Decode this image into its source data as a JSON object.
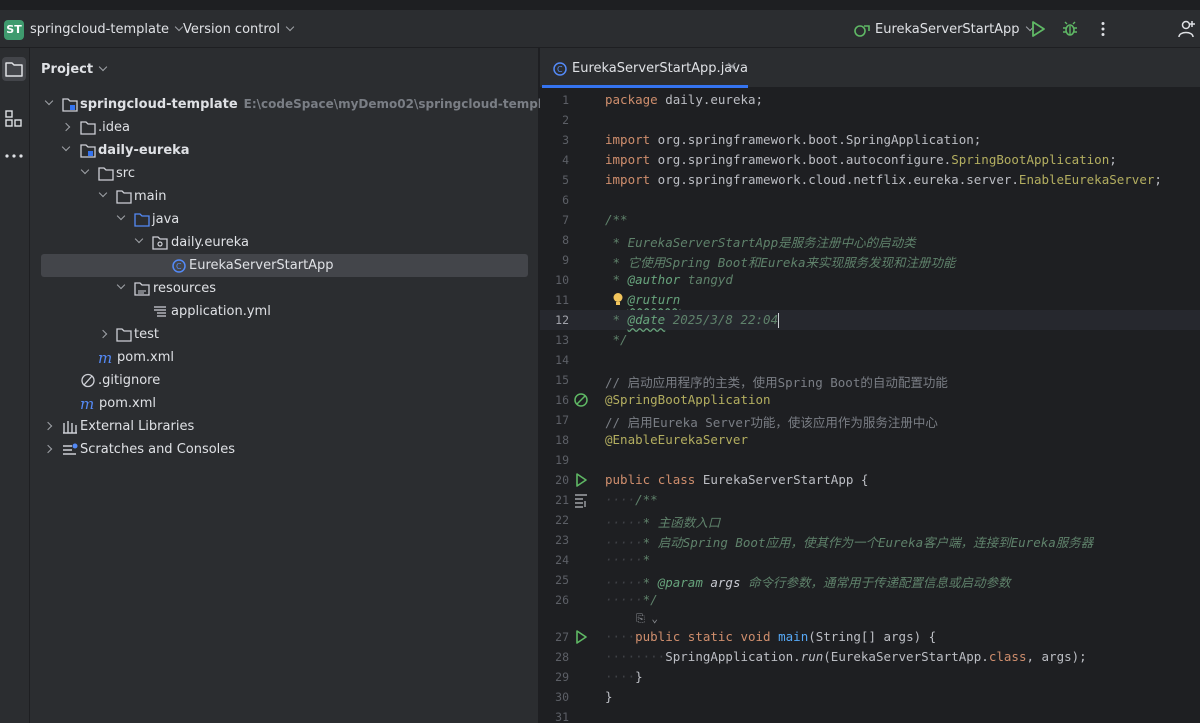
{
  "titlebar": {
    "project_badge": "ST",
    "project_name": "springcloud-template",
    "vcs_label": "Version control",
    "run_config": "EurekaServerStartApp"
  },
  "project_panel": {
    "title": "Project",
    "tree": [
      {
        "label": "springcloud-template",
        "path": "E:\\codeSpace\\myDemo02\\springcloud-template"
      },
      {
        "label": ".idea"
      },
      {
        "label": "daily-eureka"
      },
      {
        "label": "src"
      },
      {
        "label": "main"
      },
      {
        "label": "java"
      },
      {
        "label": "daily.eureka"
      },
      {
        "label": "EurekaServerStartApp"
      },
      {
        "label": "resources"
      },
      {
        "label": "application.yml"
      },
      {
        "label": "test"
      },
      {
        "label": "pom.xml"
      },
      {
        "label": ".gitignore"
      },
      {
        "label": "pom.xml"
      },
      {
        "label": "External Libraries"
      },
      {
        "label": "Scratches and Consoles"
      }
    ]
  },
  "editor": {
    "tab_label": "EurekaServerStartApp.java",
    "tab_close": "×",
    "current_line": 12,
    "inlay_hint": "⎘ ⌄",
    "lines": {
      "n": [
        "1",
        "2",
        "3",
        "4",
        "5",
        "6",
        "7",
        "8",
        "9",
        "10",
        "11",
        "12",
        "13",
        "14",
        "15",
        "16",
        "17",
        "18",
        "19",
        "20",
        "21",
        "22",
        "23",
        "24",
        "25",
        "26",
        "27",
        "28",
        "29",
        "30",
        "31"
      ],
      "l1": [
        "package",
        " daily.eureka;"
      ],
      "l3": [
        "import",
        " org.springframework.boot.SpringApplication;"
      ],
      "l4": [
        "import",
        " org.springframework.boot.autoconfigure.",
        "SpringBootApplication",
        ";"
      ],
      "l5": [
        "import",
        " org.springframework.cloud.netflix.eureka.server.",
        "EnableEurekaServer",
        ";"
      ],
      "l7": "/**",
      "l8": " * EurekaServerStartApp是服务注册中心的启动类",
      "l9": " * 它使用Spring Boot和Eureka来实现服务发现和注册功能",
      "l10": [
        " * ",
        "@author",
        " tangyd"
      ],
      "l11": [
        " ",
        "@ruturn"
      ],
      "l12": [
        " * ",
        "@date",
        " 2025/3/8 22:04"
      ],
      "l13": " */",
      "l15": "// 启动应用程序的主类，使用Spring Boot的自动配置功能",
      "l16": "@SpringBootApplication",
      "l17": "// 启用Eureka Server功能，使该应用作为服务注册中心",
      "l18": "@EnableEurekaServer",
      "l20": [
        "public",
        " ",
        "class",
        " EurekaServerStartApp {"
      ],
      "l21": [
        "····",
        "/**"
      ],
      "l22": [
        "·····",
        "* 主函数入口"
      ],
      "l23": [
        "·····",
        "* 启动Spring Boot应用，使其作为一个Eureka客户端，连接到Eureka服务器"
      ],
      "l24": [
        "·····",
        "*"
      ],
      "l25": [
        "·····",
        "* ",
        "@param",
        " args",
        " 命令行参数，通常用于传递配置信息或启动参数"
      ],
      "l26": [
        "·····",
        "*/"
      ],
      "l27": [
        "····",
        "public",
        " ",
        "static",
        " ",
        "void",
        " ",
        "main",
        "(String[] args) {"
      ],
      "l28": [
        "········",
        "SpringApplication.",
        "run",
        "(EurekaServerStartApp.",
        "class",
        ", args);"
      ],
      "l29": [
        "····",
        "}"
      ],
      "l30": "}"
    }
  },
  "colors": {
    "accent": "#3574f0",
    "badge": "#3f9b6e",
    "run_green": "#5fb865",
    "keyword": "#cf8e6d",
    "annotation": "#b3ae60",
    "doc_comment": "#5f826b"
  }
}
